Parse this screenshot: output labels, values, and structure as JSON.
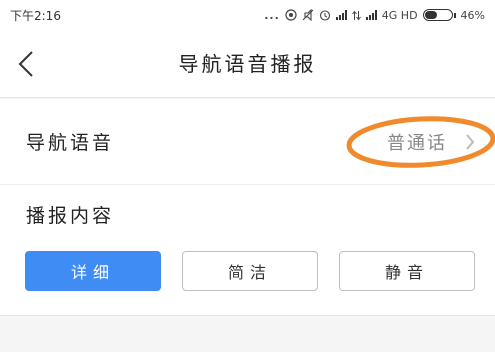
{
  "status_bar": {
    "time": "下午2:16",
    "more_dots": "...",
    "network_label": "4G HD",
    "battery_percent_text": "46%",
    "battery_level": 0.46
  },
  "header": {
    "title": "导航语音播报"
  },
  "voice_row": {
    "label": "导航语音",
    "value": "普通话"
  },
  "content_section": {
    "label": "播报内容",
    "options": [
      "详细",
      "简洁",
      "静音"
    ],
    "selected": "详细"
  },
  "colors": {
    "accent": "#3f8cf5",
    "annotation_circle": "#f08a2c"
  }
}
